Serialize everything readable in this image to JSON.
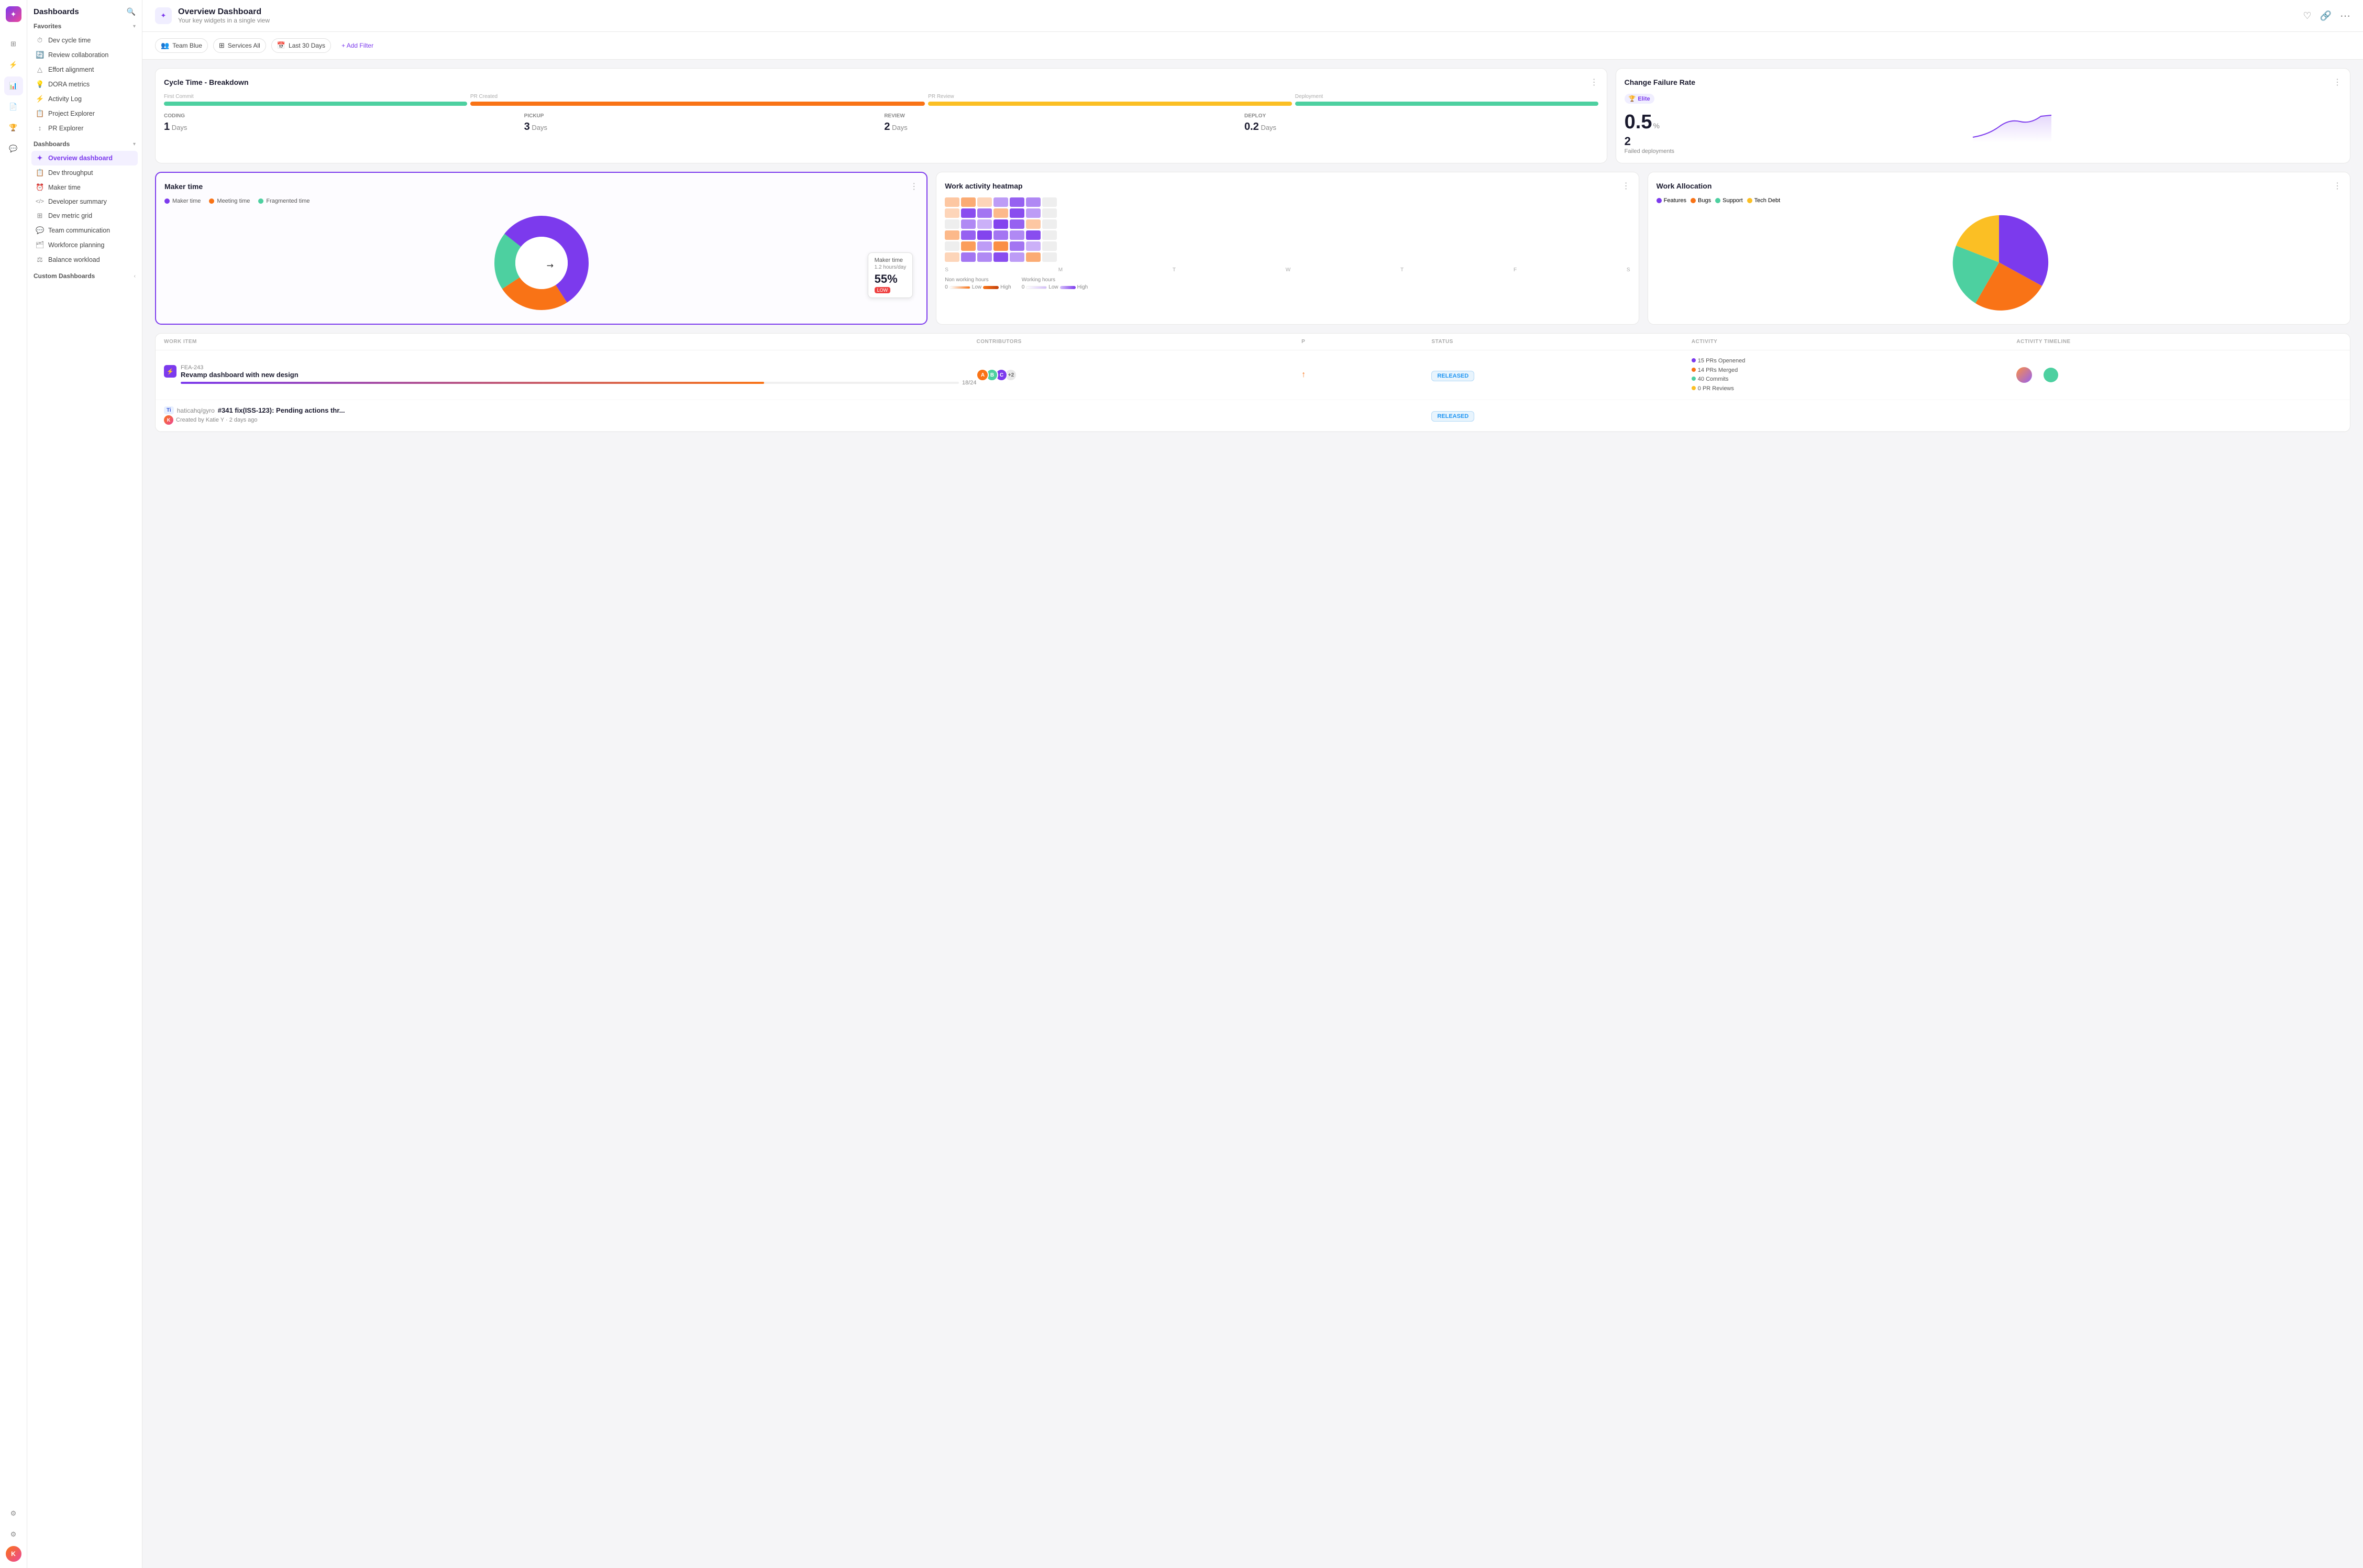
{
  "app": {
    "logo_text": "✦",
    "title": "Dashboards",
    "search_icon": "🔍"
  },
  "nav_icons": [
    {
      "id": "grid-icon",
      "symbol": "⊞",
      "active": false
    },
    {
      "id": "zap-icon",
      "symbol": "⚡",
      "active": false
    },
    {
      "id": "chart-icon",
      "symbol": "📊",
      "active": false
    },
    {
      "id": "doc-icon",
      "symbol": "📄",
      "active": false
    },
    {
      "id": "trophy-icon",
      "symbol": "🏆",
      "active": false
    },
    {
      "id": "chat-icon",
      "symbol": "💬",
      "active": false
    }
  ],
  "sidebar": {
    "favorites_label": "Favorites",
    "dashboards_label": "Dashboards",
    "custom_dashboards_label": "Custom Dashboards",
    "favorites": [
      {
        "label": "Dev cycle time",
        "icon": "⏱"
      },
      {
        "label": "Review collaboration",
        "icon": "🔄"
      },
      {
        "label": "Effort alignment",
        "icon": "△"
      },
      {
        "label": "DORA metrics",
        "icon": "💡"
      },
      {
        "label": "Activity Log",
        "icon": "⚡"
      },
      {
        "label": "Project Explorer",
        "icon": "📋"
      },
      {
        "label": "PR Explorer",
        "icon": "↕"
      }
    ],
    "dashboards": [
      {
        "label": "Overview dashboard",
        "icon": "✦",
        "active": true
      },
      {
        "label": "Dev throughput",
        "icon": "📋"
      },
      {
        "label": "Maker time",
        "icon": "⏰"
      },
      {
        "label": "Developer summary",
        "icon": "</>"
      },
      {
        "label": "Dev metric grid",
        "icon": "⊞"
      },
      {
        "label": "Team communication",
        "icon": "💬"
      },
      {
        "label": "Workforce planning",
        "icon": "🗂"
      },
      {
        "label": "Balance workload",
        "icon": "⚖"
      }
    ]
  },
  "header": {
    "icon": "✦",
    "title": "Overview Dashboard",
    "subtitle": "Your key widgets in a single view",
    "heart_icon": "♡",
    "link_icon": "🔗",
    "menu_icon": "⋯"
  },
  "filters": {
    "team_blue": "Team Blue",
    "services_all": "Services All",
    "last_30_days": "Last 30 Days",
    "add_filter": "+ Add Filter"
  },
  "cycle_time": {
    "title": "Cycle Time - Breakdown",
    "stages": [
      {
        "name": "First Commit",
        "label": "CODING",
        "value": "1",
        "unit": "Days",
        "color": "#4dd0a0"
      },
      {
        "name": "PR Created",
        "label": "PICKUP",
        "value": "3",
        "unit": "Days",
        "color": "#f97316"
      },
      {
        "name": "PR Review",
        "label": "REVIEW",
        "value": "2",
        "unit": "Days",
        "color": "#fbbf24"
      },
      {
        "name": "Deployment",
        "label": "DEPLOY",
        "value": "0.2",
        "unit": "Days",
        "color": "#4dd0a0"
      }
    ]
  },
  "change_failure_rate": {
    "title": "Change Failure Rate",
    "badge": "Elite",
    "badge_icon": "🏆",
    "percent": "0.5",
    "percent_unit": "%",
    "failed_count": "2",
    "failed_label": "Failed deployments"
  },
  "maker_time": {
    "title": "Maker time",
    "legend": [
      {
        "label": "Maker time",
        "color": "#7c3aed"
      },
      {
        "label": "Meeting time",
        "color": "#f97316"
      },
      {
        "label": "Fragmented time",
        "color": "#4dd0a0"
      }
    ],
    "tooltip": {
      "label": "Maker time",
      "hours": "1.2 hours/day",
      "percent": "55%",
      "badge": "LOW"
    },
    "segments": [
      {
        "value": 55,
        "color": "#7c3aed"
      },
      {
        "value": 25,
        "color": "#f97316"
      },
      {
        "value": 20,
        "color": "#4dd0a0"
      }
    ]
  },
  "heatmap": {
    "title": "Work activity heatmap",
    "days": [
      "S",
      "M",
      "T",
      "W",
      "T",
      "F",
      "S"
    ],
    "legend_left_label": "Non working hours",
    "legend_right_label": "Working hours"
  },
  "work_allocation": {
    "title": "Work Allocation",
    "legend": [
      {
        "label": "Features",
        "color": "#7c3aed"
      },
      {
        "label": "Bugs",
        "color": "#f97316"
      },
      {
        "label": "Support",
        "color": "#4dd0a0"
      },
      {
        "label": "Tech Debt",
        "color": "#fbbf24"
      }
    ]
  },
  "table": {
    "columns": [
      "WORK ITEM",
      "CONTRIBUTORS",
      "P",
      "STATUS",
      "ACTIVITY",
      "ACTIVITY TIMELINE"
    ],
    "rows": [
      {
        "id": "FEA-243",
        "title": "Revamp dashboard with new design",
        "icon": "⚡",
        "icon_bg": "#7c3aed",
        "progress": 18,
        "total": 24,
        "progress_color": "linear-gradient(90deg, #7c3aed, #f97316)",
        "contributors": [
          "#f97316",
          "#4dd0a0",
          "#7c3aed"
        ],
        "extra": "+2",
        "priority": "↑",
        "status": "RELEASED",
        "activity": [
          "15 PRs Openened",
          "14 PRs Merged",
          "40 Commits",
          "0 PR Reviews"
        ],
        "activity_colors": [
          "#7c3aed",
          "#f97316",
          "#4dd0a0",
          "#fbbf24"
        ]
      },
      {
        "id": "Ti",
        "repo": "haticahq/gyro",
        "title": "#341 fix(ISS-123): Pending actions thr...",
        "user": "Created by Katie Y · 2 days ago",
        "priority": "",
        "status": "RELEASED",
        "activity": [],
        "activity_colors": []
      }
    ]
  }
}
